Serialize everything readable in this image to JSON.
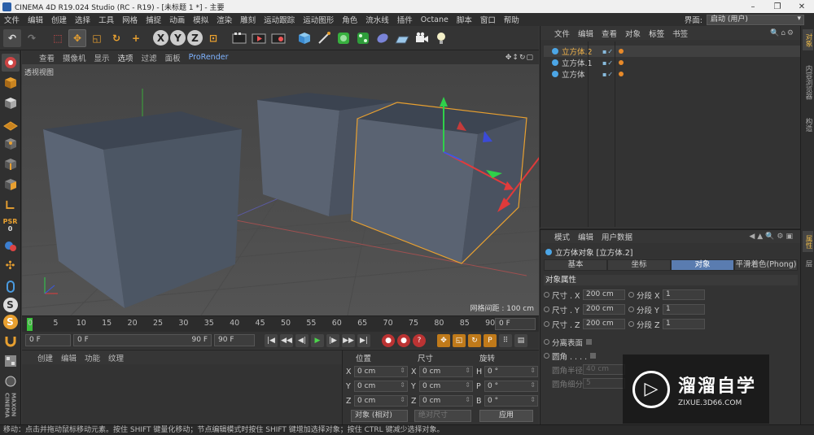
{
  "window": {
    "title": "CINEMA 4D R19.024 Studio (RC - R19) - [未标题 1 *] - 主要",
    "minimize": "–",
    "restore": "❐",
    "close": "✕"
  },
  "menubar": {
    "items": [
      "文件",
      "编辑",
      "创建",
      "选择",
      "工具",
      "网格",
      "捕捉",
      "动画",
      "模拟",
      "渲染",
      "雕刻",
      "运动跟踪",
      "运动图形",
      "角色",
      "流水线",
      "插件",
      "Octane",
      "脚本",
      "窗口",
      "帮助"
    ],
    "layout_label": "界面:",
    "layout_value": "启动 (用户)"
  },
  "toolbar": {
    "undo": "↶",
    "redo": "↷",
    "select": "⬚",
    "move": "✥",
    "scale": "◱",
    "rotate": "↻",
    "add": "+",
    "axis_x": "X",
    "axis_y": "Y",
    "axis_z": "Z",
    "coord": "⊡"
  },
  "viewport": {
    "menu": [
      "查看",
      "摄像机",
      "显示",
      "选项",
      "过滤",
      "面板",
      "ProRender"
    ],
    "nav_icons": "✥↕↻▢",
    "label": "透视视图",
    "grid_readout": "网格间距 : 100 cm"
  },
  "timeline": {
    "ticks": [
      "0",
      "5",
      "10",
      "15",
      "20",
      "25",
      "30",
      "35",
      "40",
      "45",
      "50",
      "55",
      "60",
      "65",
      "70",
      "75",
      "80",
      "85",
      "90"
    ],
    "current_frame": "0 F"
  },
  "transport": {
    "start": "0 F",
    "range_start": "0 F",
    "range_end": "90 F",
    "end": "90 F"
  },
  "material": {
    "menu": [
      "创建",
      "编辑",
      "功能",
      "纹理"
    ]
  },
  "coords": {
    "headers": [
      "位置",
      "尺寸",
      "旋转"
    ],
    "pos": [
      {
        "axis": "X",
        "value": "0 cm"
      },
      {
        "axis": "Y",
        "value": "0 cm"
      },
      {
        "axis": "Z",
        "value": "0 cm"
      }
    ],
    "size": [
      {
        "axis": "X",
        "value": "0 cm"
      },
      {
        "axis": "Y",
        "value": "0 cm"
      },
      {
        "axis": "Z",
        "value": "0 cm"
      }
    ],
    "rot": [
      {
        "axis": "H",
        "value": "0 °"
      },
      {
        "axis": "P",
        "value": "0 °"
      },
      {
        "axis": "B",
        "value": "0 °"
      }
    ],
    "mode": "对象 (相对)",
    "size_mode": "绝对尺寸",
    "apply": "应用"
  },
  "objects": {
    "menu": [
      "文件",
      "编辑",
      "查看",
      "对象",
      "标签",
      "书签"
    ],
    "tools": "🔍⌂⚙",
    "items": [
      {
        "name": "立方体.2",
        "selected": true
      },
      {
        "name": "立方体.1",
        "selected": false
      },
      {
        "name": "立方体",
        "selected": false
      }
    ],
    "flags": "▪✓"
  },
  "attributes": {
    "menu": [
      "模式",
      "编辑",
      "用户数据"
    ],
    "tools": "◀▲🔍⚙▣",
    "title": "立方体对象 [立方体.2]",
    "tabs": [
      "基本",
      "坐标",
      "对象",
      "平滑着色(Phong)"
    ],
    "active_tab": "对象",
    "section": "对象属性",
    "rows": [
      {
        "label": "尺寸 . X",
        "value": "200 cm",
        "seg_label": "分段 X",
        "seg_value": "1"
      },
      {
        "label": "尺寸 . Y",
        "value": "200 cm",
        "seg_label": "分段 Y",
        "seg_value": "1"
      },
      {
        "label": "尺寸 . Z",
        "value": "200 cm",
        "seg_label": "分段 Z",
        "seg_value": "1"
      }
    ],
    "separate_surfaces": "分离表面",
    "fillet": "圆角 . . . .",
    "fillet_radius_label": "圆角半径",
    "fillet_radius": "40 cm",
    "fillet_subdiv_label": "圆角细分",
    "fillet_subdiv": "5"
  },
  "right_rail": [
    "对象",
    "内容浏览器",
    "构造",
    "属性",
    "层"
  ],
  "status": "移动：点击并拖动鼠标移动元素。按住 SHIFT 键量化移动；节点编辑模式时按住 SHIFT 键增加选择对象；按住 CTRL 键减少选择对象。",
  "watermark": {
    "name": "溜溜自学",
    "url": "ZIXUE.3D66.COM"
  },
  "colors": {
    "accent_blue": "#5a7cb0",
    "selected_orange": "#f0b24a",
    "annotation_red": "#e03a3a"
  }
}
